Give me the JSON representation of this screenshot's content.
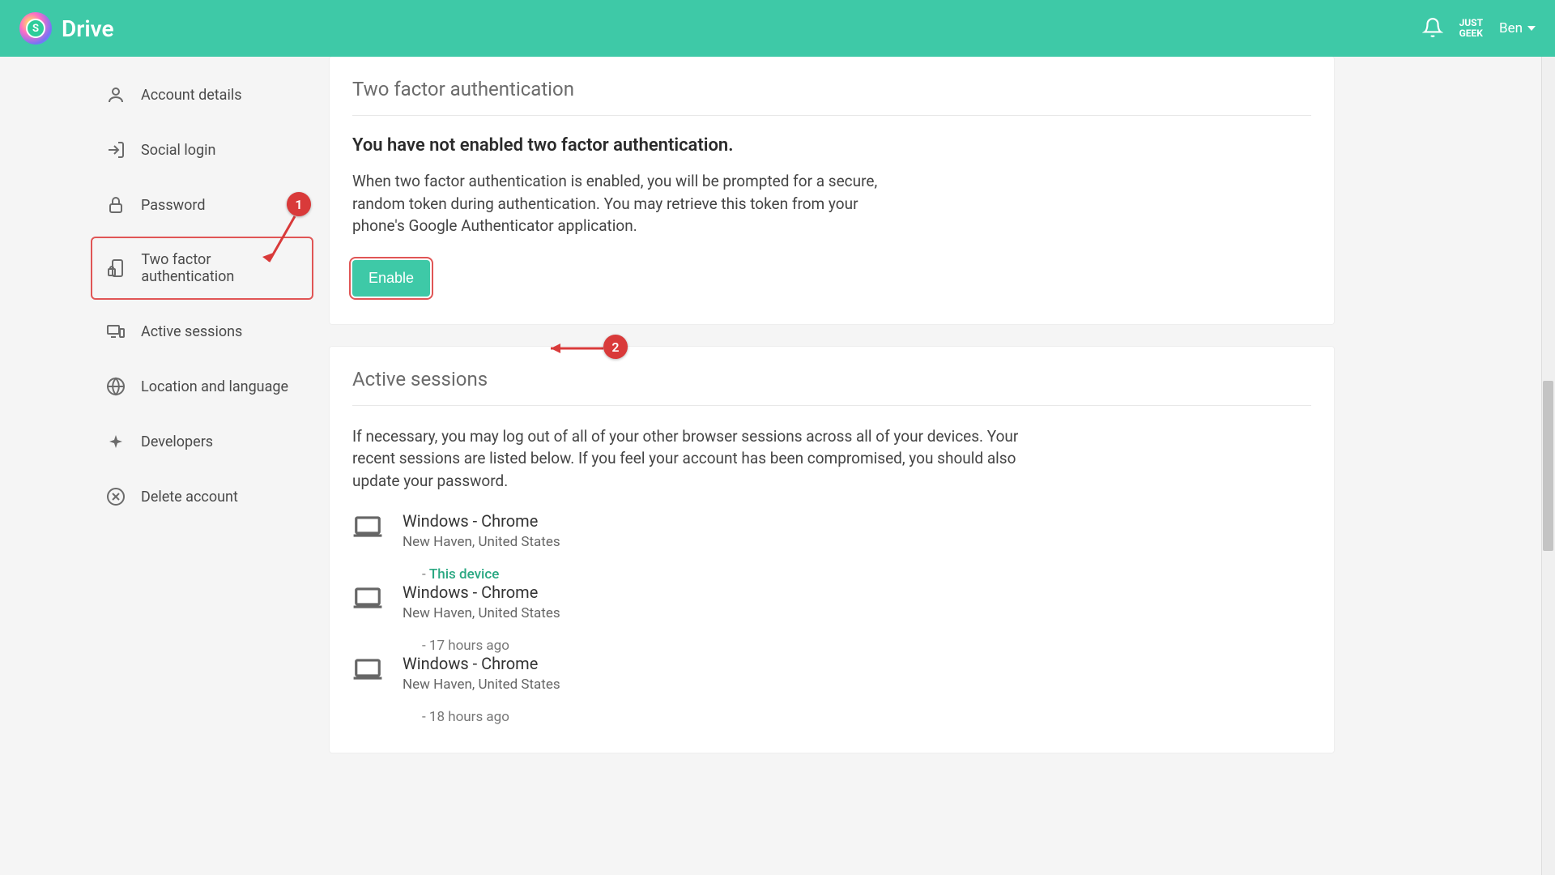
{
  "header": {
    "brand": "Drive",
    "badge_line1": "JUST",
    "badge_line2": "GEEK",
    "user_name": "Ben"
  },
  "sidebar": {
    "items": [
      {
        "key": "account-details",
        "label": "Account details",
        "icon": "person-icon"
      },
      {
        "key": "social-login",
        "label": "Social login",
        "icon": "login-arrow-icon"
      },
      {
        "key": "password",
        "label": "Password",
        "icon": "lock-icon"
      },
      {
        "key": "two-factor",
        "label": "Two factor authentication",
        "icon": "device-lock-icon",
        "active": true
      },
      {
        "key": "active-sessions",
        "label": "Active sessions",
        "icon": "devices-icon"
      },
      {
        "key": "location-language",
        "label": "Location and language",
        "icon": "globe-icon"
      },
      {
        "key": "developers",
        "label": "Developers",
        "icon": "api-icon"
      },
      {
        "key": "delete-account",
        "label": "Delete account",
        "icon": "close-circle-icon"
      }
    ]
  },
  "tfa": {
    "title": "Two factor authentication",
    "status": "You have not enabled two factor authentication.",
    "description": "When two factor authentication is enabled, you will be prompted for a secure, random token during authentication. You may retrieve this token from your phone's Google Authenticator application.",
    "enable_label": "Enable"
  },
  "sessions": {
    "title": "Active sessions",
    "description": "If necessary, you may log out of all of your other browser sessions across all of your devices. Your recent sessions are listed below. If you feel your account has been compromised, you should also update your password.",
    "list": [
      {
        "device": "Windows - Chrome",
        "location": "New Haven, United States",
        "meta_prefix": " - ",
        "meta": "This device",
        "this_device": true
      },
      {
        "device": "Windows - Chrome",
        "location": "New Haven, United States",
        "meta_prefix": " - ",
        "meta": "17 hours ago",
        "this_device": false
      },
      {
        "device": "Windows - Chrome",
        "location": "New Haven, United States",
        "meta_prefix": " - ",
        "meta": "18 hours ago",
        "this_device": false
      }
    ]
  },
  "annotations": {
    "badge1": "1",
    "badge2": "2"
  },
  "colors": {
    "accent": "#3ec9a7",
    "annotation": "#d93a3a"
  }
}
